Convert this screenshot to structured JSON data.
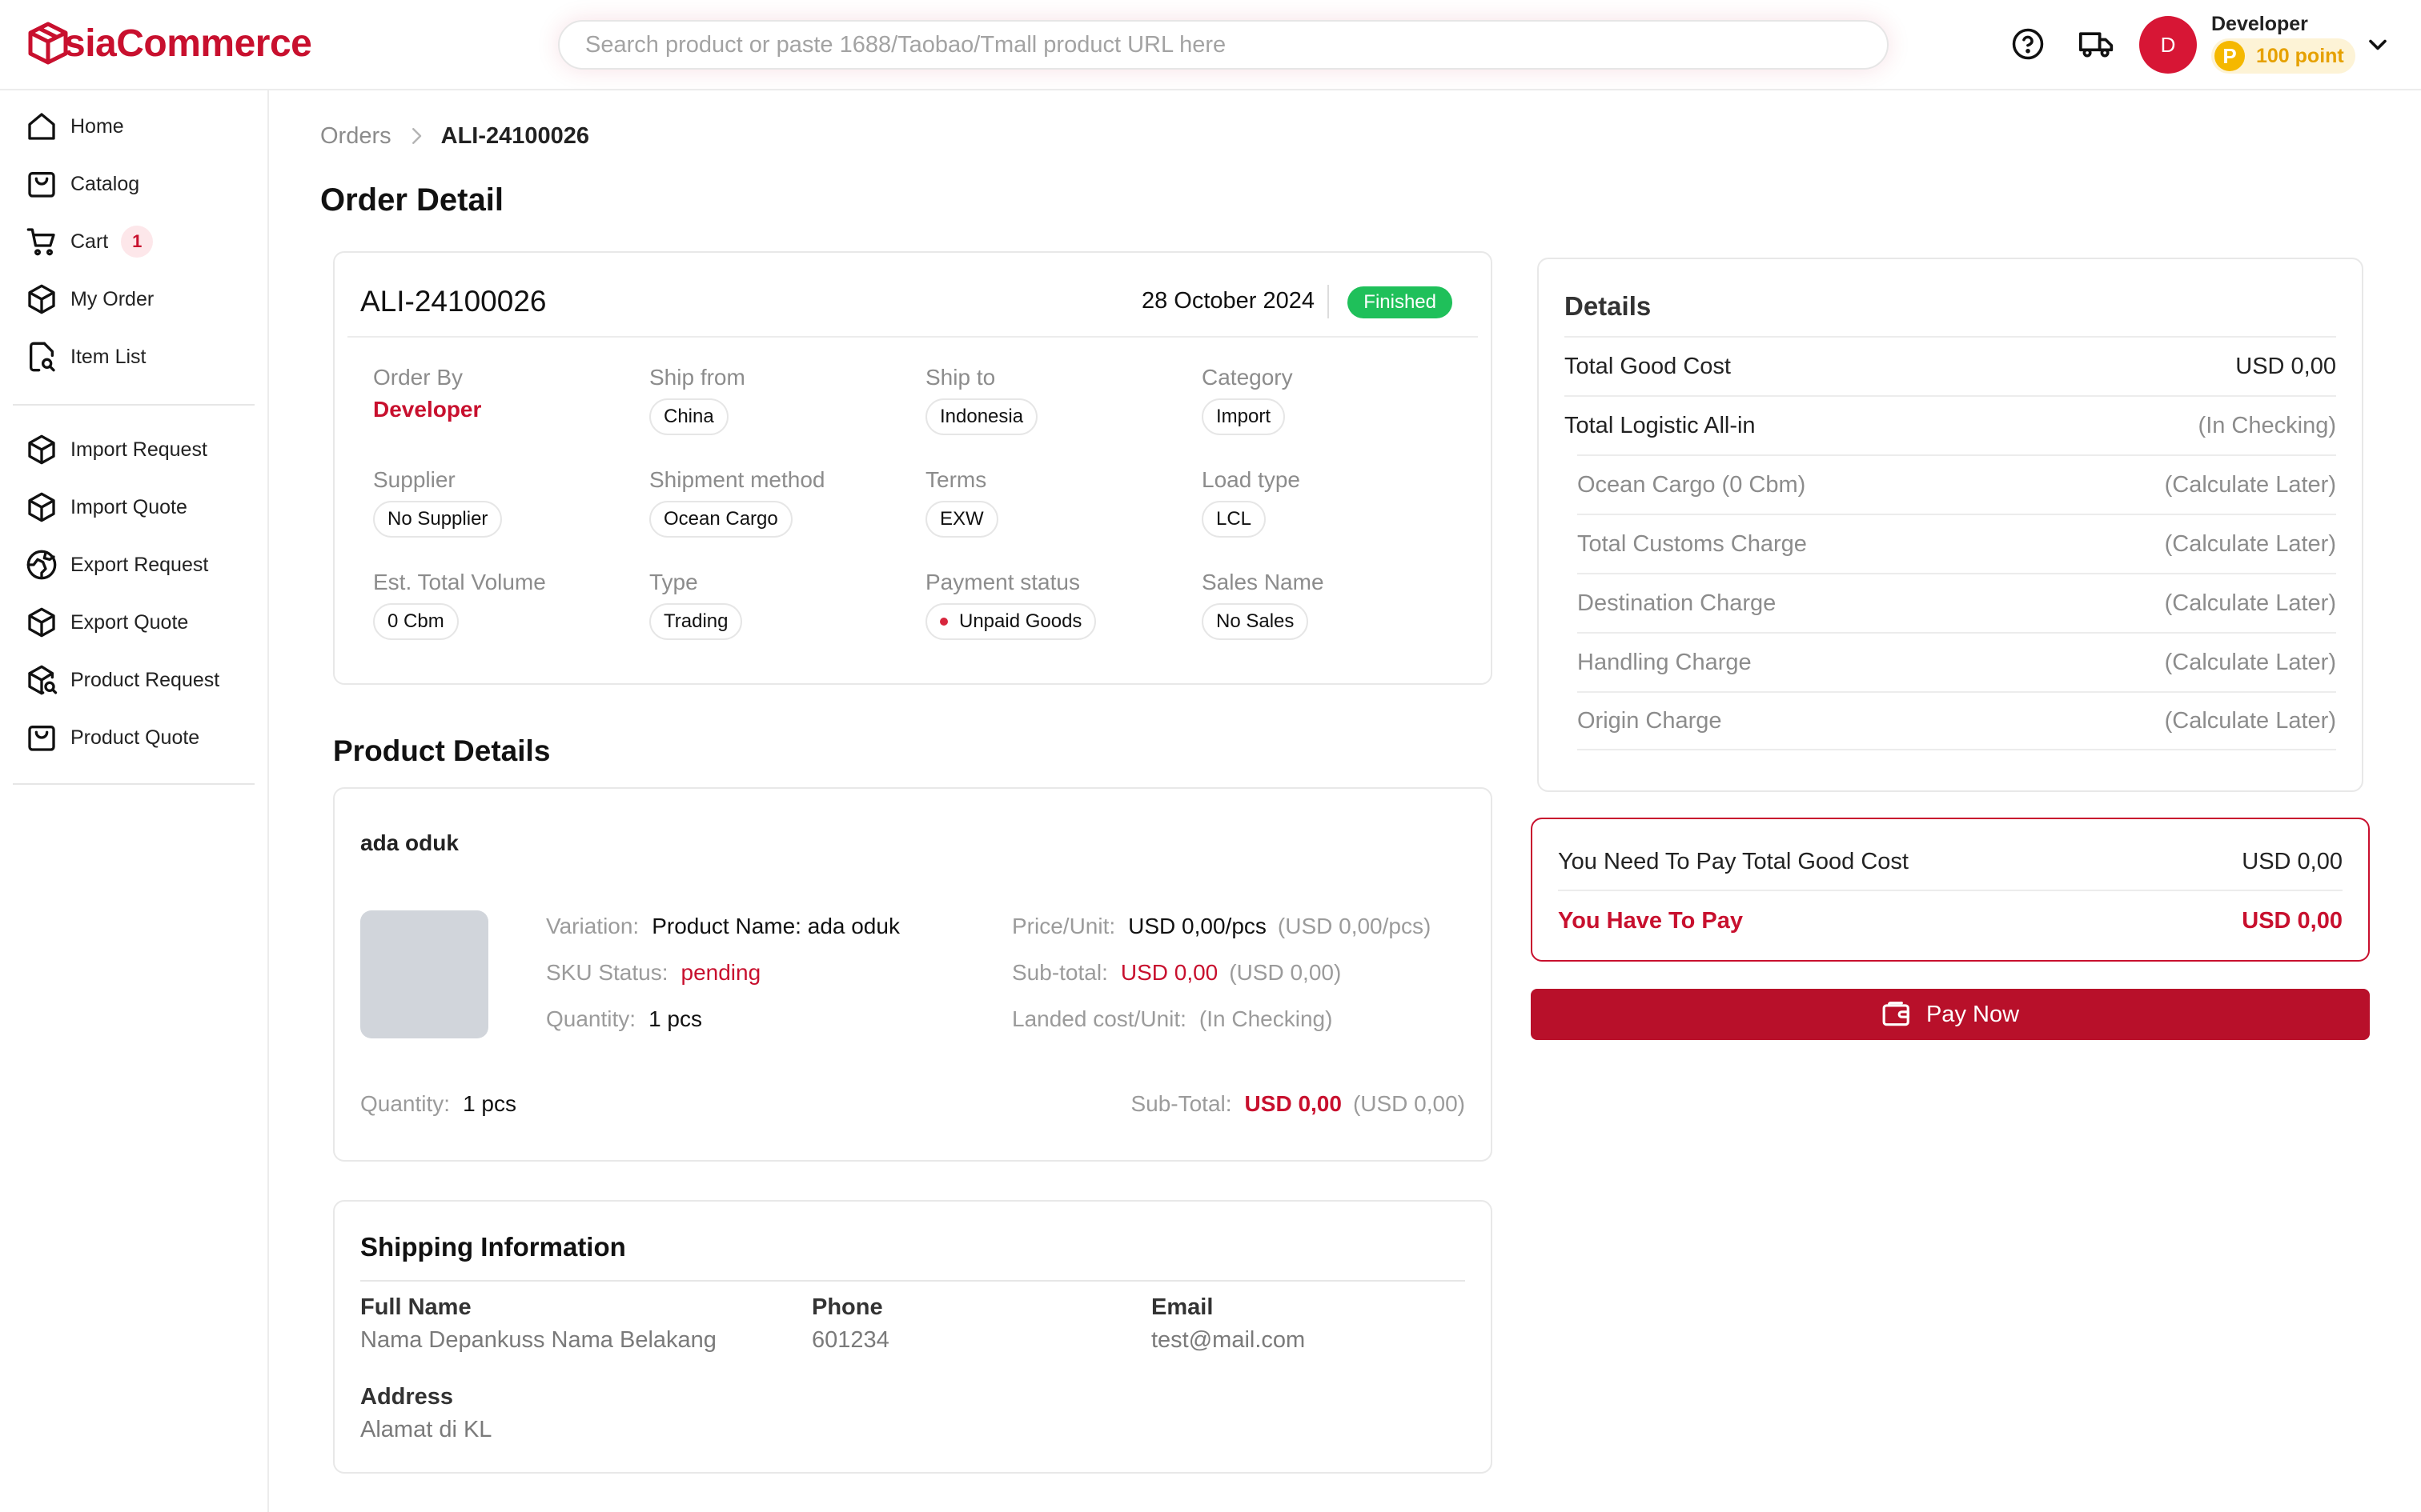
{
  "app": {
    "brand": "siaCommerce",
    "brand_color": "#c8102e"
  },
  "header": {
    "search_placeholder": "Search product or paste 1688/Taobao/Tmall product URL here",
    "help_icon": "help-circle-icon",
    "shipping_icon": "truck-icon",
    "user": {
      "avatar_initial": "D",
      "name": "Developer",
      "points_symbol": "P",
      "points": "100 point"
    }
  },
  "sidebar": {
    "group1": [
      {
        "label": "Home",
        "icon": "home-icon"
      },
      {
        "label": "Catalog",
        "icon": "catalog-icon"
      },
      {
        "label": "Cart",
        "icon": "cart-icon",
        "badge": "1"
      },
      {
        "label": "My Order",
        "icon": "box-icon"
      },
      {
        "label": "Item List",
        "icon": "item-list-icon"
      }
    ],
    "group2": [
      {
        "label": "Import Request",
        "icon": "box-icon"
      },
      {
        "label": "Import Quote",
        "icon": "box-icon"
      },
      {
        "label": "Export Request",
        "icon": "globe-icon"
      },
      {
        "label": "Export Quote",
        "icon": "box-icon"
      },
      {
        "label": "Product Request",
        "icon": "box-search-icon"
      },
      {
        "label": "Product Quote",
        "icon": "catalog-icon"
      }
    ]
  },
  "breadcrumb": {
    "parent": "Orders",
    "current": "ALI-24100026"
  },
  "page_title": "Order Detail",
  "order": {
    "id": "ALI-24100026",
    "date": "28 October 2024",
    "status": "Finished",
    "status_color": "#1fc05a",
    "fields": {
      "order_by": {
        "label": "Order By",
        "value": "Developer"
      },
      "ship_from": {
        "label": "Ship from",
        "value": "China"
      },
      "ship_to": {
        "label": "Ship to",
        "value": "Indonesia"
      },
      "category": {
        "label": "Category",
        "value": "Import"
      },
      "supplier": {
        "label": "Supplier",
        "value": "No Supplier"
      },
      "shipment_method": {
        "label": "Shipment method",
        "value": "Ocean Cargo"
      },
      "terms": {
        "label": "Terms",
        "value": "EXW"
      },
      "load_type": {
        "label": "Load type",
        "value": "LCL"
      },
      "volume": {
        "label": "Est. Total Volume",
        "value": "0 Cbm"
      },
      "type": {
        "label": "Type",
        "value": "Trading"
      },
      "payment_status": {
        "label": "Payment status",
        "value": "Unpaid Goods"
      },
      "sales_name": {
        "label": "Sales Name",
        "value": "No Sales"
      }
    }
  },
  "product_section": {
    "title": "Product Details",
    "product": {
      "name": "ada oduk",
      "variation_label": "Variation:",
      "variation": "Product Name: ada oduk",
      "sku_label": "SKU Status:",
      "sku_status": "pending",
      "quantity_label": "Quantity:",
      "quantity": "1 pcs",
      "price_label": "Price/Unit:",
      "price": "USD 0,00/pcs",
      "price_alt": "(USD 0,00/pcs)",
      "subtotal_label": "Sub-total:",
      "subtotal": "USD 0,00",
      "subtotal_alt": "(USD 0,00)",
      "landed_label": "Landed cost/Unit:",
      "landed": "(In Checking)"
    },
    "footer": {
      "quantity_label": "Quantity:",
      "quantity": "1 pcs",
      "subtotal_label": "Sub-Total:",
      "subtotal": "USD 0,00",
      "subtotal_alt": "(USD 0,00)"
    }
  },
  "shipping": {
    "title": "Shipping Information",
    "full_name_label": "Full Name",
    "full_name": "Nama Depankuss Nama Belakang",
    "phone_label": "Phone",
    "phone": "601234",
    "email_label": "Email",
    "email": "test@mail.com",
    "address_label": "Address",
    "address": "Alamat di KL"
  },
  "details": {
    "title": "Details",
    "rows": [
      {
        "label": "Total Good Cost",
        "value": "USD 0,00"
      },
      {
        "label": "Total Logistic All-in",
        "value": "(In Checking)"
      },
      {
        "label": "Ocean Cargo (0 Cbm)",
        "value": "(Calculate Later)"
      },
      {
        "label": "Total Customs Charge",
        "value": "(Calculate Later)"
      },
      {
        "label": "Destination Charge",
        "value": "(Calculate Later)"
      },
      {
        "label": "Handling Charge",
        "value": "(Calculate Later)"
      },
      {
        "label": "Origin Charge",
        "value": "(Calculate Later)"
      }
    ]
  },
  "payment": {
    "need_label": "You Need To Pay Total Good Cost",
    "need_value": "USD 0,00",
    "have_label": "You Have To Pay",
    "have_value": "USD 0,00",
    "button": "Pay Now"
  }
}
